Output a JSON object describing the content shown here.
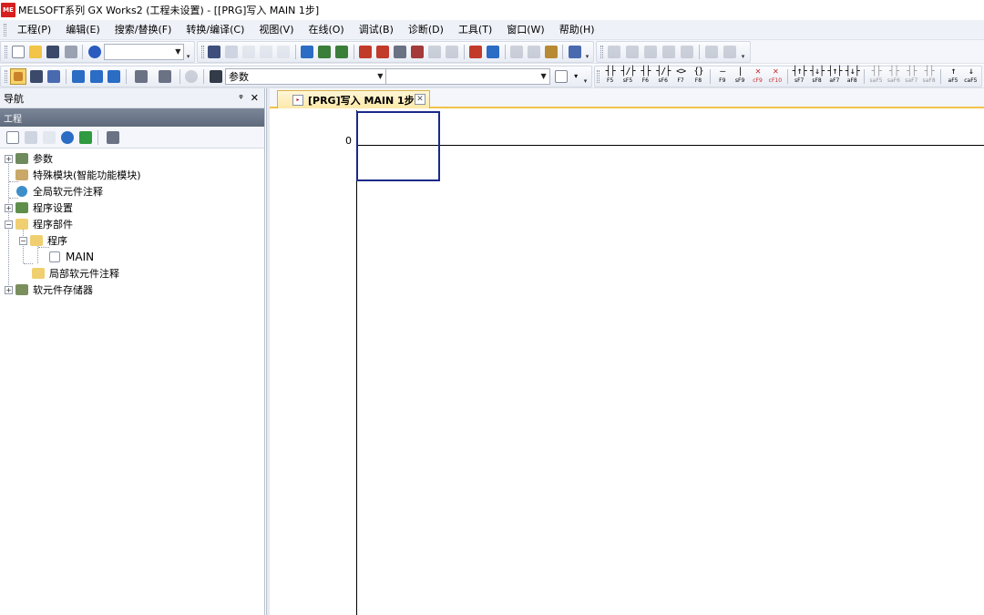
{
  "window": {
    "title": "MELSOFT系列 GX Works2 (工程未设置) - [[PRG]写入 MAIN 1步]",
    "logo_text": "ME"
  },
  "menu": {
    "items": [
      {
        "label": "工程(P)"
      },
      {
        "label": "编辑(E)"
      },
      {
        "label": "搜索/替换(F)"
      },
      {
        "label": "转换/编译(C)"
      },
      {
        "label": "视图(V)"
      },
      {
        "label": "在线(O)"
      },
      {
        "label": "调试(B)"
      },
      {
        "label": "诊断(D)"
      },
      {
        "label": "工具(T)"
      },
      {
        "label": "窗口(W)"
      },
      {
        "label": "帮助(H)"
      }
    ]
  },
  "toolbar": {
    "standard_combo_value": "",
    "param_combo_value": "参数",
    "device_combo_value": ""
  },
  "function_keys": [
    {
      "sym": "┤├",
      "label": "F5"
    },
    {
      "sym": "┤/├",
      "label": "sF5"
    },
    {
      "sym": "┤├",
      "label": "F6"
    },
    {
      "sym": "┤/├",
      "label": "sF6"
    },
    {
      "sym": "<>",
      "label": "F7"
    },
    {
      "sym": "{}",
      "label": "F8"
    },
    {
      "sym": "—",
      "label": "F9"
    },
    {
      "sym": "|",
      "label": "sF9"
    },
    {
      "sym": "✕",
      "label": "cF9"
    },
    {
      "sym": "✕",
      "label": "cF10"
    },
    {
      "sym": "┤↑├",
      "label": "sF7"
    },
    {
      "sym": "┤↓├",
      "label": "sF8"
    },
    {
      "sym": "┤↑├",
      "label": "aF7"
    },
    {
      "sym": "┤↓├",
      "label": "aF8"
    },
    {
      "sym": "┤├",
      "label": "saF5"
    },
    {
      "sym": "┤├",
      "label": "saF6"
    },
    {
      "sym": "┤├",
      "label": "saF7"
    },
    {
      "sym": "┤├",
      "label": "saF8"
    },
    {
      "sym": "↑",
      "label": "aF5"
    },
    {
      "sym": "↓",
      "label": "caF5"
    }
  ],
  "navigation": {
    "title": "导航",
    "pin": "ᵠ",
    "close": "✕",
    "project_label": "工程",
    "tree": [
      {
        "label": "参数"
      },
      {
        "label": "特殊模块(智能功能模块)"
      },
      {
        "label": "全局软元件注释"
      },
      {
        "label": "程序设置"
      },
      {
        "label": "程序部件"
      },
      {
        "label": "程序"
      },
      {
        "label": "MAIN"
      },
      {
        "label": "局部软元件注释"
      },
      {
        "label": "软元件存储器"
      }
    ]
  },
  "editor": {
    "tab_label": "[PRG]写入 MAIN 1步",
    "tab_close": "✕",
    "step_number": "0"
  },
  "colors": {
    "accent_tab": "#fde9a8",
    "cursor": "#1a2a8a",
    "logo": "#d71f1f"
  }
}
